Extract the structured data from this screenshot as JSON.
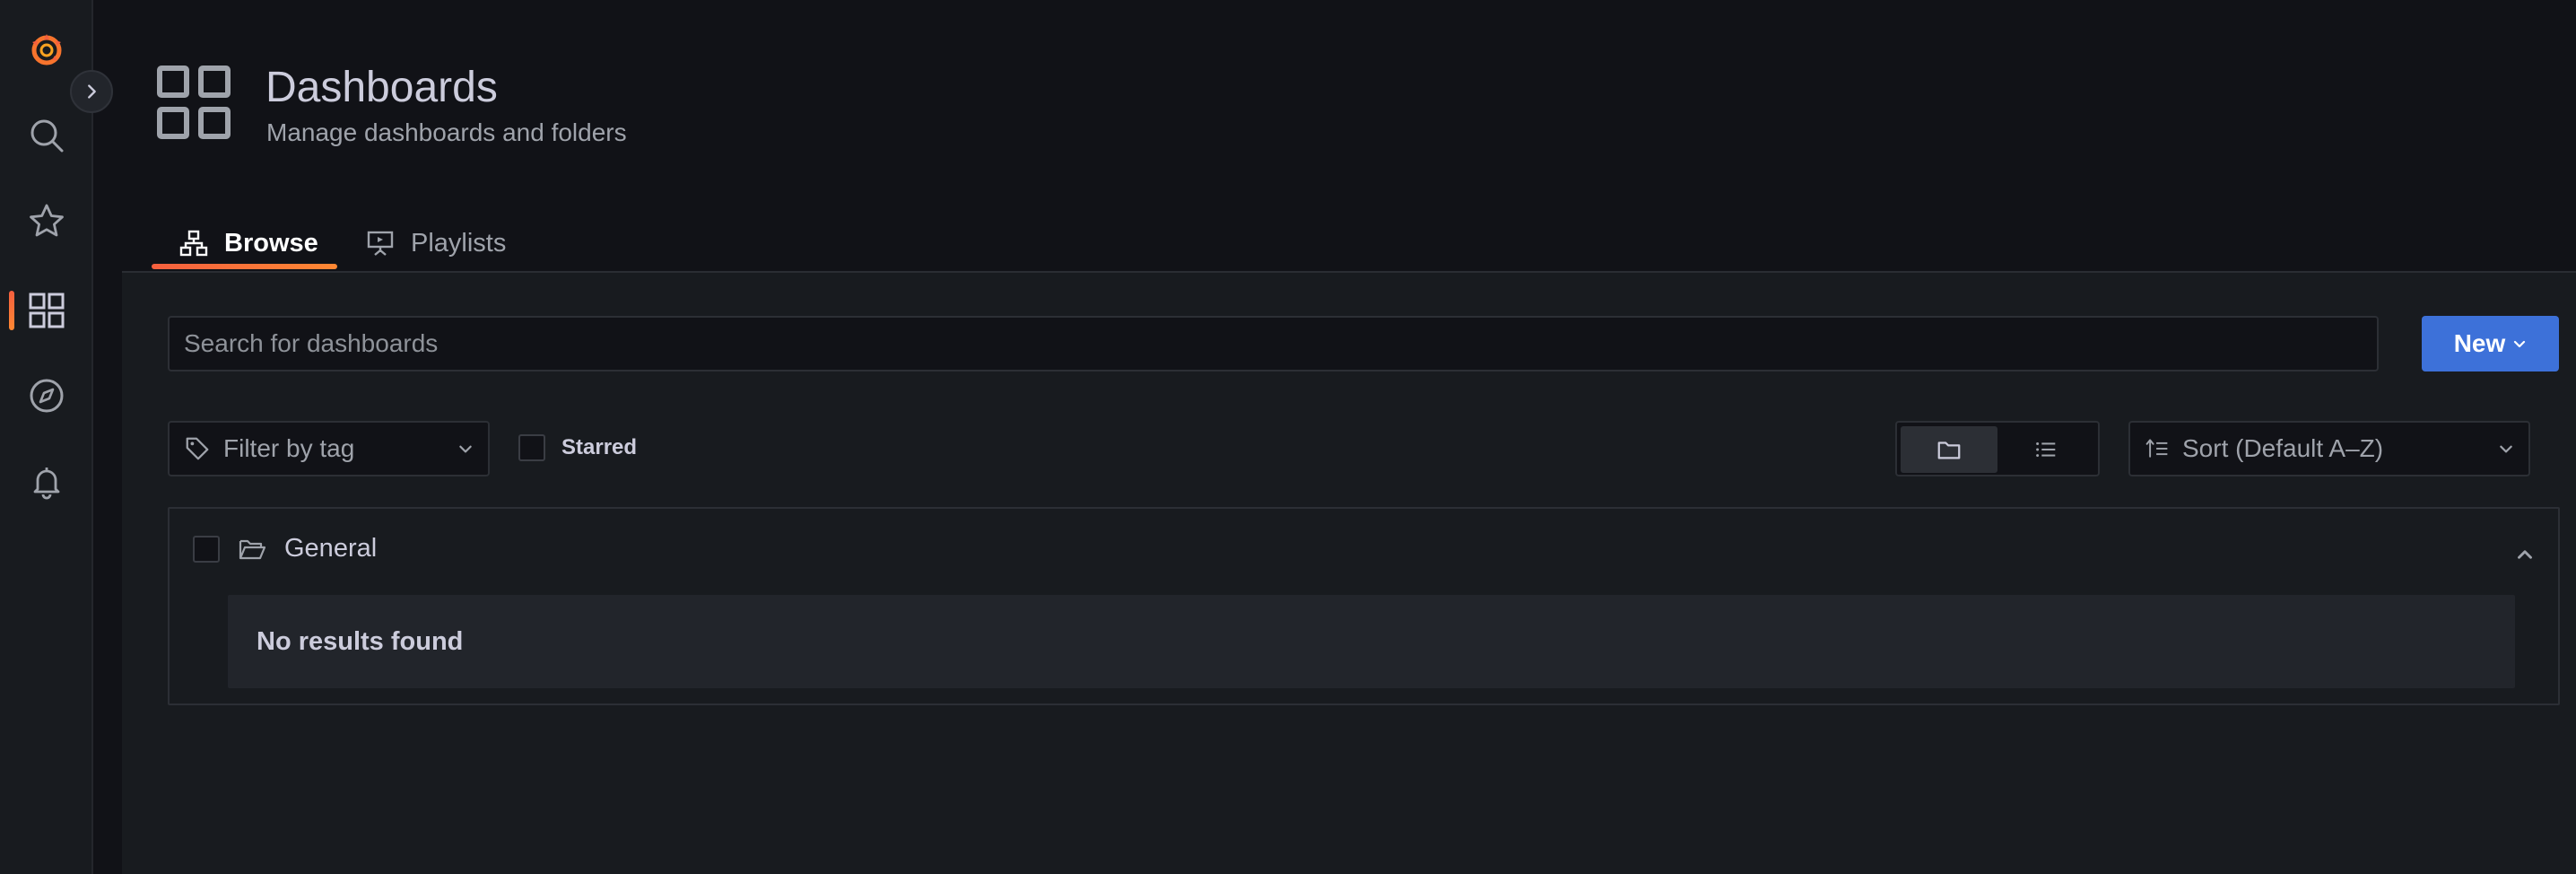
{
  "sidebar": {
    "items": [
      {
        "icon": "grafana-logo-icon"
      },
      {
        "icon": "search-icon"
      },
      {
        "icon": "star-icon"
      },
      {
        "icon": "dashboards-grid-icon",
        "active": true
      },
      {
        "icon": "compass-explore-icon"
      },
      {
        "icon": "bell-alerting-icon"
      }
    ],
    "toggle_icon": "chevron-right-icon"
  },
  "header": {
    "title": "Dashboards",
    "subtitle": "Manage dashboards and folders",
    "icon": "dashboards-grid-icon"
  },
  "tabs": [
    {
      "label": "Browse",
      "icon": "sitemap-icon",
      "active": true
    },
    {
      "label": "Playlists",
      "icon": "presentation-icon",
      "active": false
    }
  ],
  "search": {
    "placeholder": "Search for dashboards",
    "value": ""
  },
  "new_button": {
    "label": "New",
    "icon": "chevron-down-icon"
  },
  "filter": {
    "placeholder": "Filter by tag",
    "icon": "tag-icon"
  },
  "starred": {
    "label": "Starred",
    "checked": false
  },
  "view_toggle": {
    "selected": "folders",
    "options": [
      "folder-view-icon",
      "list-view-icon"
    ]
  },
  "sort": {
    "label": "Sort (Default A–Z)",
    "icon": "sort-ascending-icon"
  },
  "folder": {
    "name": "General",
    "icon": "folder-open-icon",
    "collapsed": false,
    "empty_message": "No results found"
  },
  "colors": {
    "accent_orange": "#f55f3e",
    "primary_blue": "#3d71d9",
    "bg": "#111217",
    "panel": "#181b1f"
  }
}
